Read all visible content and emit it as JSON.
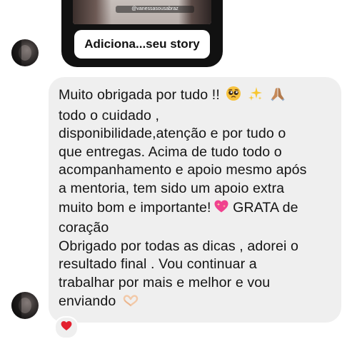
{
  "story_reply": {
    "handle": "@vanessasousabraz",
    "button_label": "Adiciona...seu story"
  },
  "message": {
    "lines": [
      "Muito obrigada por tudo !!",
      "todo o cuidado ,",
      "disponibilidade,atenção e por tudo o",
      "que entregas. Acima de tudo todo o",
      "acompanhamento e apoio mesmo após",
      "a mentoria, tem sido um apoio extra",
      "muito bom e importante!",
      "coração",
      "Obrigado por todas as dicas , adorei o",
      "resultado final . Vou continuar a",
      "trabalhar por mais e melhor e vou",
      "enviando"
    ],
    "line7_suffix": "GRATA de",
    "emojis": {
      "line1": [
        "pleading-face",
        "sparkles",
        "folded-hands"
      ],
      "line7": "sparkling-heart",
      "line12": "heart-hands"
    }
  },
  "reaction": {
    "icon": "red-heart",
    "color": "#e3202f"
  },
  "colors": {
    "bubble_background": "#efefef",
    "text": "#141414",
    "page_background": "#ffffff"
  }
}
